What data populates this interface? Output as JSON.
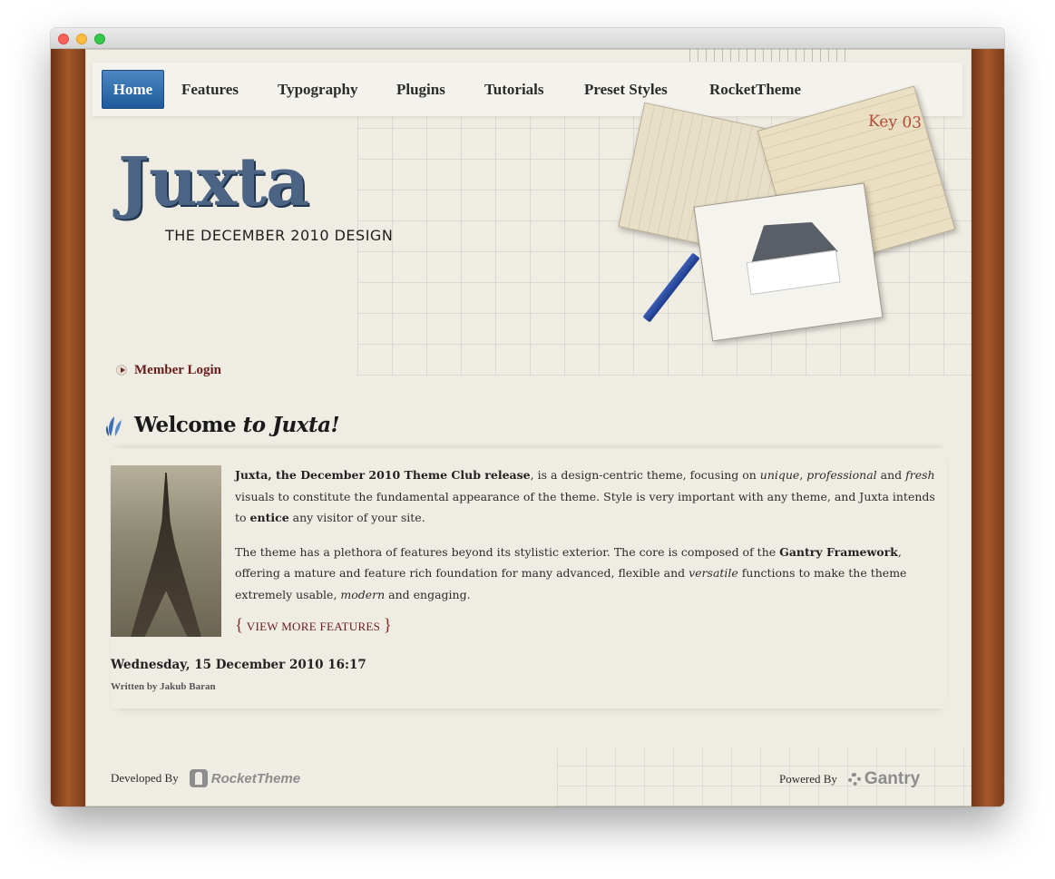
{
  "nav": {
    "items": [
      {
        "label": "Home",
        "active": true
      },
      {
        "label": "Features"
      },
      {
        "label": "Typography"
      },
      {
        "label": "Plugins"
      },
      {
        "label": "Tutorials"
      },
      {
        "label": "Preset Styles"
      },
      {
        "label": "RocketTheme"
      }
    ]
  },
  "logo": {
    "word": "Juxta",
    "subtitle": "THE DECEMBER 2010 DESIGN"
  },
  "collage": {
    "card_note": "Key 03"
  },
  "member_login": {
    "label": "Member Login"
  },
  "welcome": {
    "title_plain": "Welcome",
    "title_italic": "to Juxta!"
  },
  "article": {
    "p1": {
      "bold_lead": "Juxta, the December 2010 Theme Club release",
      "t1": ", is a design-centric theme, focusing on ",
      "i1": "unique",
      "t2": ", ",
      "i2": "professional",
      "t3": " and ",
      "i3": "fresh",
      "t4": " visuals to constitute the fundamental appearance of the theme. Style is very important with any theme, and Juxta intends to ",
      "b2": "entice",
      "t5": " any visitor of your site."
    },
    "p2": {
      "t1": "The theme has a plethora of features beyond its stylistic exterior. The core is composed of the ",
      "b1": "Gantry Framework",
      "t2": ", offering a mature and feature rich foundation for many advanced, flexible and ",
      "i1": "versatile",
      "t3": " functions to make the theme extremely usable, ",
      "i2": "modern",
      "t4": " and engaging."
    },
    "more_label": "VIEW MORE FEATURES",
    "brace_open": "{",
    "brace_close": "}",
    "date": "Wednesday, 15 December 2010 16:17",
    "author": "Written by Jakub Baran"
  },
  "footer": {
    "developed_label": "Developed By",
    "developer_logo": "RocketTheme",
    "powered_label": "Powered By",
    "powered_logo": "Gantry"
  },
  "colors": {
    "nav_active": "#2f6fb0",
    "link_red": "#6b1c1a",
    "paper": "#efece3",
    "wood": "#8e4a21"
  }
}
